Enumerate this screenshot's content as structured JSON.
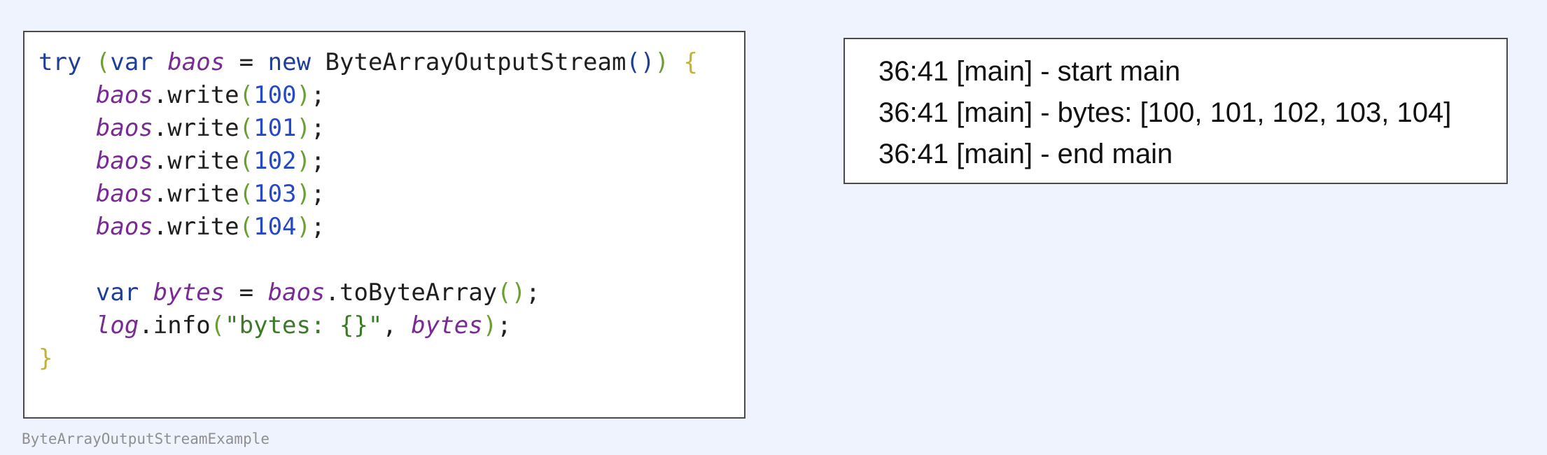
{
  "code_block": {
    "tokens": {
      "l1_try": "try",
      "l1_paren_open": "(",
      "l1_var": "var",
      "l1_baos": "baos",
      "l1_eq": "=",
      "l1_new": "new",
      "l1_class": "ByteArrayOutputStream",
      "l1_ctor_parens": "()",
      "l1_paren_close": ")",
      "l1_brace_open": "{",
      "write_baos": "baos",
      "write_method": ".write",
      "arg_open": "(",
      "arg_close": ")",
      "semicolon": ";",
      "w1_val": "100",
      "w2_val": "101",
      "w3_val": "102",
      "w4_val": "103",
      "w5_val": "104",
      "l8_var": "var",
      "l8_bytes": "bytes",
      "l8_eq": "=",
      "l8_baos": "baos",
      "l8_method": ".toByteArray",
      "l8_parens": "()",
      "l9_log": "log",
      "l9_method": ".info",
      "l9_string": "\"bytes: {}\"",
      "l9_comma": ",",
      "l9_bytes": "bytes",
      "l10_brace_close": "}"
    }
  },
  "caption": "ByteArrayOutputStreamExample",
  "console": {
    "lines": [
      "36:41 [main] - start main",
      "36:41 [main] - bytes: [100, 101, 102, 103, 104]",
      "36:41 [main] - end main"
    ]
  },
  "colors": {
    "background": "#eff3fd",
    "keyword": "#1f3e9a",
    "variable": "#7a2a94",
    "number": "#2448c9",
    "string": "#3c7a2a",
    "paren_level1": "#6aa02f",
    "brace": "#c2b23a"
  }
}
